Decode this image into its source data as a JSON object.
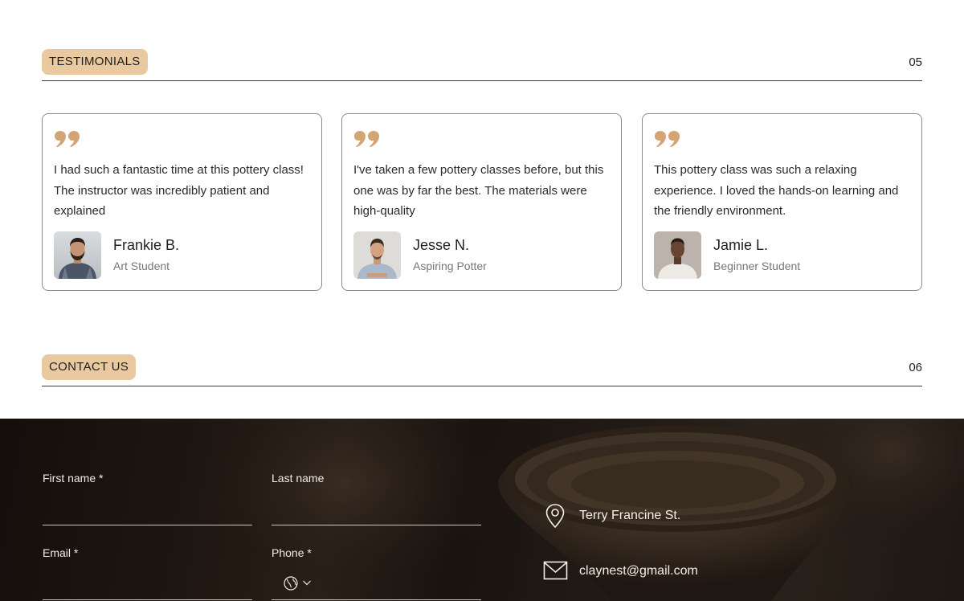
{
  "testimonials": {
    "tag": "TESTIMONIALS",
    "number": "05",
    "items": [
      {
        "quote": "I had such a fantastic time at this pottery class! The instructor was incredibly patient and explained",
        "name": "Frankie B.",
        "role": "Art Student"
      },
      {
        "quote": "I've taken a few pottery classes before, but this one was by far the best. The materials were high-quality",
        "name": "Jesse N.",
        "role": "Aspiring Potter"
      },
      {
        "quote": "This pottery class was such a relaxing experience. I loved the hands-on learning and the friendly environment.",
        "name": "Jamie L.",
        "role": "Beginner Student"
      }
    ]
  },
  "contact": {
    "tag": "CONTACT US",
    "number": "06",
    "form": {
      "first_name_label": "First name *",
      "last_name_label": "Last name",
      "email_label": "Email *",
      "phone_label": "Phone *"
    },
    "address": "Terry Francine St.",
    "email": "claynest@gmail.com"
  },
  "colors": {
    "tag_bg": "#e8c9a0",
    "quote_icon": "#d4a574"
  },
  "icons": [
    "quote-icon",
    "location-pin-icon",
    "mail-icon",
    "globe-icon",
    "chevron-down-icon"
  ]
}
